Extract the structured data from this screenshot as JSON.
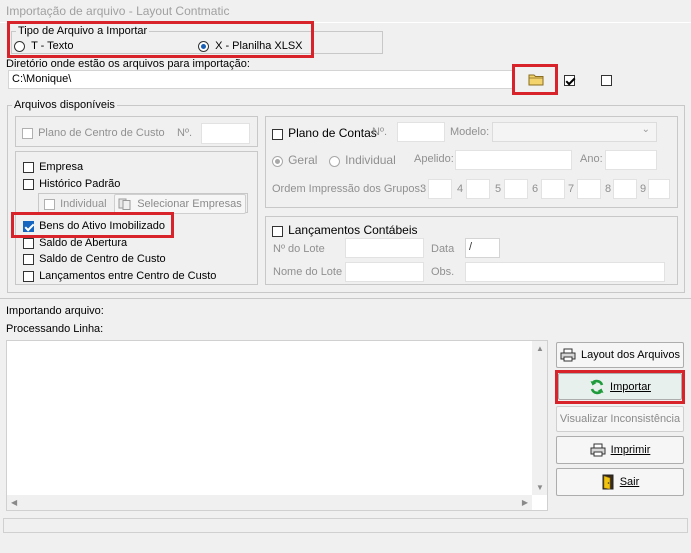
{
  "window": {
    "title": "Importação de arquivo - Layout Contmatic"
  },
  "tipo": {
    "legend": "Tipo de Arquivo a Importar",
    "option_t": "T - Texto",
    "option_x": "X - Planilha XLSX",
    "selected": "X"
  },
  "diretorio": {
    "label": "Diretório onde estão os arquivos para importação:",
    "value": "C:\\Monique\\"
  },
  "arquivos": {
    "legend": "Arquivos disponíveis",
    "plano_centro_custo": "Plano de Centro de Custo",
    "no_label": "Nº.",
    "empresa": "Empresa",
    "historico": "Histórico Padrão",
    "individual": "Individual",
    "selecionar_empresas": "Selecionar Empresas",
    "bens_ativo": "Bens do Ativo Imobilizado",
    "saldo_abertura": "Saldo de Abertura",
    "saldo_centro_custo": "Saldo de Centro de Custo",
    "lanc_centro_custo": "Lançamentos entre Centro de Custo",
    "plano_contas": "Plano de Contas",
    "plano_contas_no": "Nº.",
    "modelo": "Modelo:",
    "geral": "Geral",
    "individual2": "Individual",
    "apelido": "Apelido:",
    "ano": "Ano:",
    "ordem": "Ordem Impressão dos Grupos:",
    "grupos": [
      "3",
      "4",
      "5",
      "6",
      "7",
      "8",
      "9"
    ],
    "lanc_contabeis": "Lançamentos Contábeis",
    "no_lote": "Nº do Lote",
    "data": "Data",
    "data_value": "/",
    "nome_lote": "Nome do Lote",
    "obs": "Obs."
  },
  "status": {
    "importando": "Importando arquivo:",
    "processando": "Processando Linha:"
  },
  "buttons": {
    "layout": "Layout dos Arquivos",
    "importar": "Importar",
    "visualizar": "Visualizar Inconsistência",
    "imprimir": "Imprimir",
    "sair": "Sair"
  },
  "colors": {
    "highlight": "#d9232b",
    "accent": "#1565c0"
  }
}
